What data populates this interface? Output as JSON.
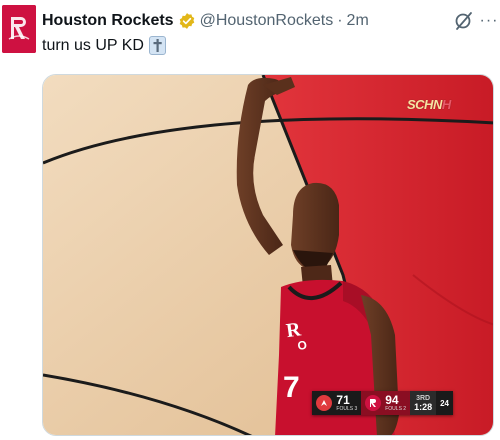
{
  "tweet": {
    "display_name": "Houston Rockets",
    "handle": "@HoustonRockets",
    "separator": "·",
    "time": "2m",
    "text": "turn us UP KD",
    "emoji": "latin-cross-emoji"
  },
  "icons": {
    "avatar": "houston-rockets-logo",
    "verified": "verified-badge-icon",
    "grok": "grok-icon",
    "more": "more-options-icon"
  },
  "more_glyph": "···",
  "media": {
    "description_type": "video-frame",
    "watermark": {
      "main": "SCHN",
      "accent": "H"
    },
    "scoreboard": {
      "away_score": "71",
      "away_fouls": "FOULS 3",
      "home_score": "94",
      "home_fouls": "FOULS 2",
      "period": "3RD",
      "clock": "1:28",
      "shot_clock": "24"
    },
    "jersey_number": "7"
  },
  "colors": {
    "brand_red": "#ce1141",
    "verified_gold": "#e2b719",
    "text_secondary": "#536471",
    "court_red": "#d9232d",
    "court_wood": "#e6c49a"
  }
}
